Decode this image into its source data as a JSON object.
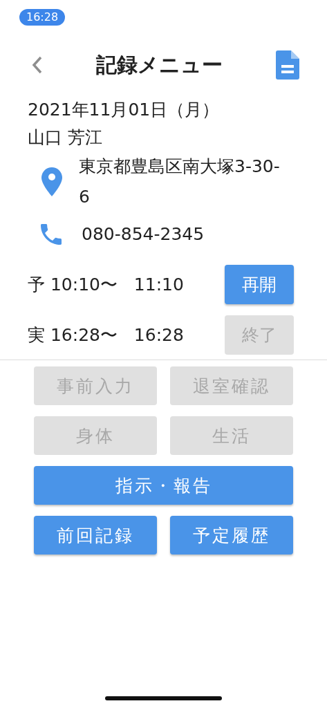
{
  "status_bar": {
    "time": "16:28"
  },
  "header": {
    "title": "記録メニュー"
  },
  "visit": {
    "date": "2021年11月01日（月）",
    "name": "山口 芳江",
    "address": "東京都豊島区南大塚3-30-6",
    "phone": "080-854-2345"
  },
  "schedule": [
    {
      "label": "予",
      "start": "10:10〜",
      "end": "11:10",
      "button": {
        "label": "再開",
        "disabled": false
      }
    },
    {
      "label": "実",
      "start": "16:28〜",
      "end": "16:28",
      "button": {
        "label": "終了",
        "disabled": true
      }
    }
  ],
  "menu_buttons": [
    {
      "label": "事前入力",
      "kind": "half",
      "disabled": true
    },
    {
      "label": "退室確認",
      "kind": "half",
      "disabled": true
    },
    {
      "label": "身体",
      "kind": "half",
      "disabled": true
    },
    {
      "label": "生活",
      "kind": "half",
      "disabled": true
    },
    {
      "label": "指示・報告",
      "kind": "full",
      "disabled": false
    },
    {
      "label": "前回記録",
      "kind": "half",
      "disabled": false
    },
    {
      "label": "予定履歴",
      "kind": "half",
      "disabled": false
    }
  ]
}
